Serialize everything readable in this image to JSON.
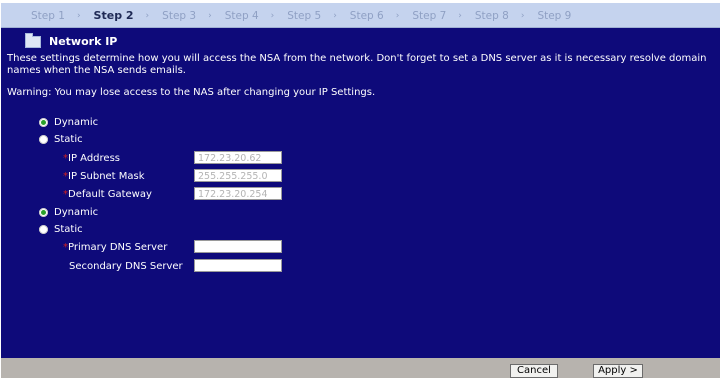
{
  "wizard": {
    "steps": [
      "Step 1",
      "Step 2",
      "Step 3",
      "Step 4",
      "Step 5",
      "Step 6",
      "Step 7",
      "Step 8",
      "Step 9"
    ],
    "separator": "›",
    "active_step": "Step 2"
  },
  "section": {
    "title": "Network IP",
    "description": "These settings determine how you will access the NSA from the network. Don't forget to set a DNS server as it is necessary resolve domain names when the NSA sends emails.",
    "warning": "Warning: You may lose access to the NAS after changing your IP Settings."
  },
  "ip": {
    "dynamic_label": "Dynamic",
    "static_label": "Static",
    "selected": "Dynamic",
    "required_mark": "*",
    "ip_address_label": "IP Address",
    "ip_address_value": "172.23.20.62",
    "subnet_mask_label": "IP Subnet Mask",
    "subnet_mask_value": "255.255.255.0",
    "gateway_label": "Default Gateway",
    "gateway_value": "172.23.20.254"
  },
  "dns": {
    "dynamic_label": "Dynamic",
    "static_label": "Static",
    "selected": "Dynamic",
    "primary_label": "Primary DNS Server",
    "primary_value": "",
    "secondary_label": "Secondary DNS Server",
    "secondary_value": ""
  },
  "footer": {
    "cancel_label": "Cancel",
    "apply_label": "Apply >"
  },
  "colors": {
    "content_bg": "#0e0a7a",
    "stepbar_bg": "#c5d3ee",
    "footer_bg": "#b7b3ae",
    "radio_selected": "#2aa12a",
    "required": "#d02020"
  },
  "icons": {
    "title_icon": "folder-icon",
    "step_separator": "chevron-right-icon"
  }
}
